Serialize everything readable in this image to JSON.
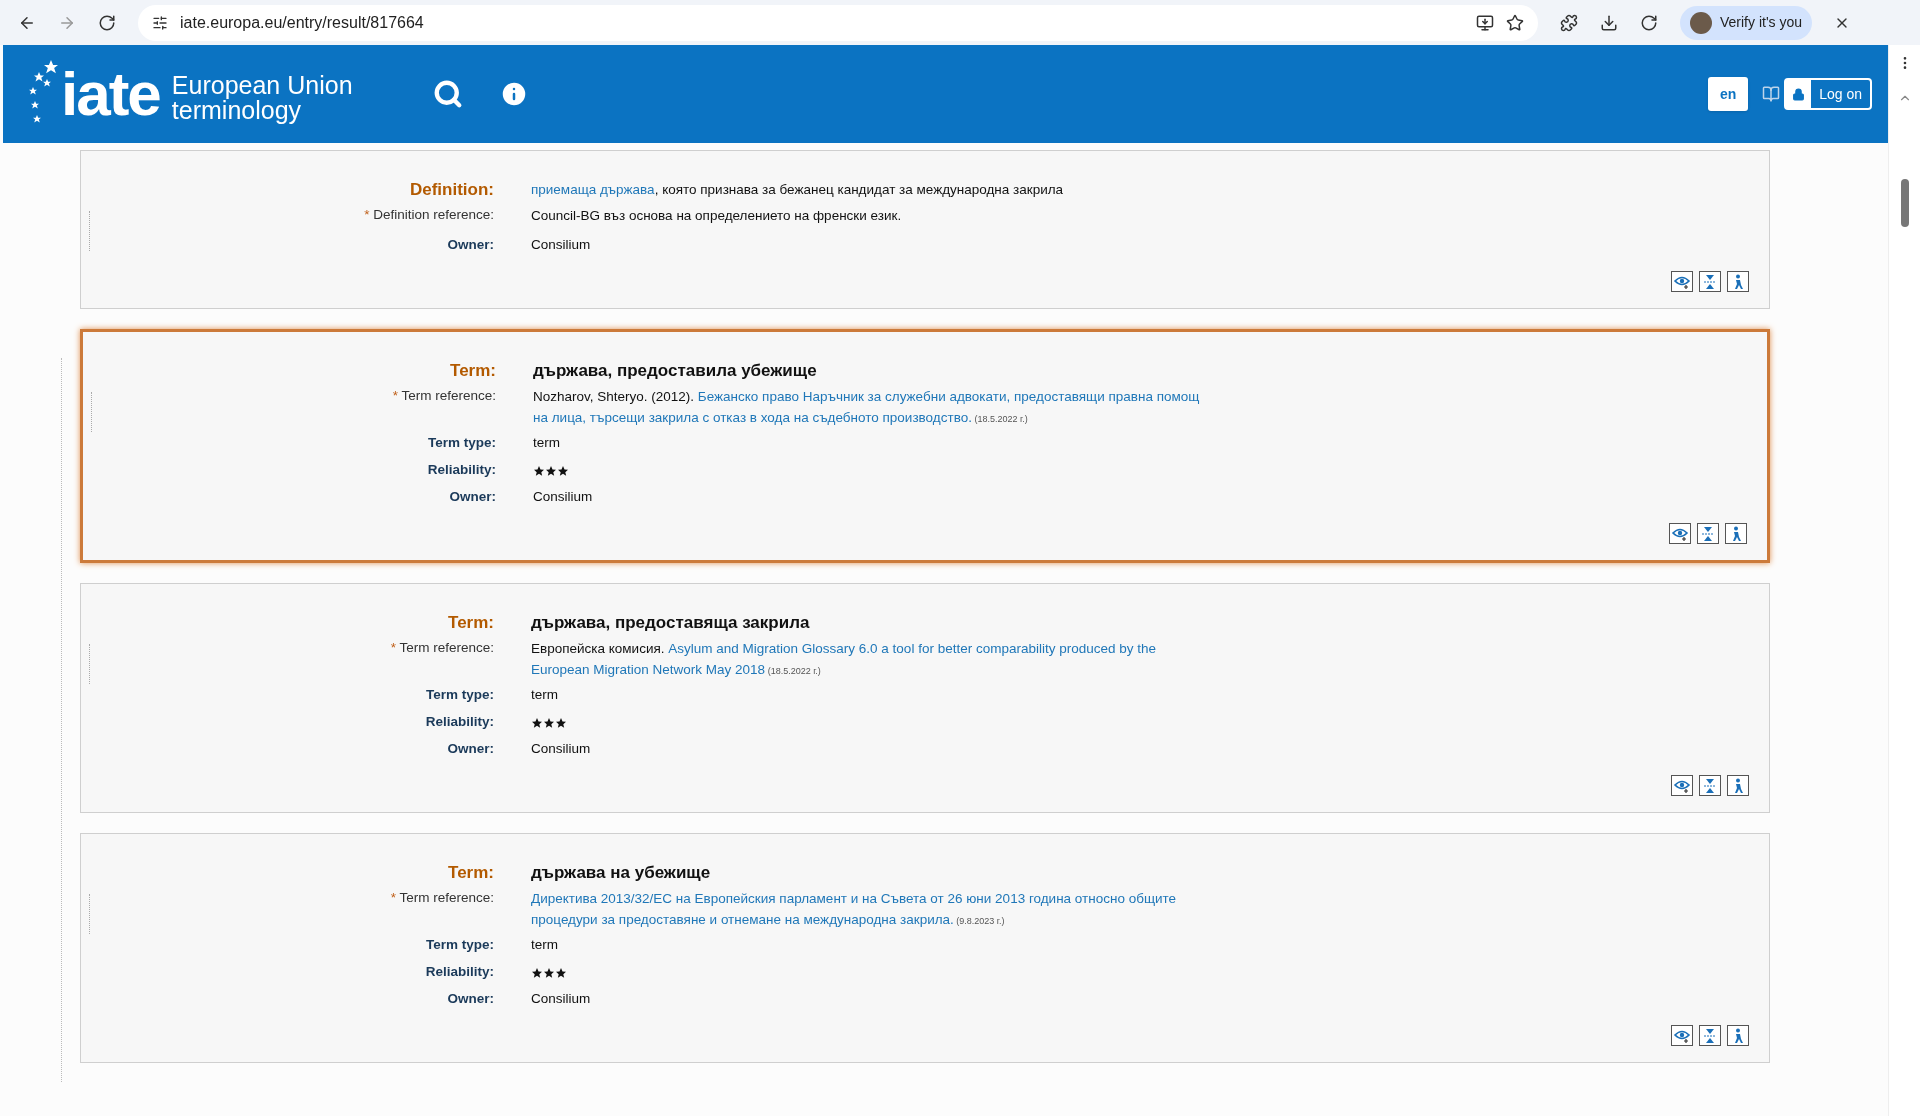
{
  "browser": {
    "url": "iate.europa.eu/entry/result/817664",
    "profile_label": "Verify it's you"
  },
  "header": {
    "logo_text": "iate",
    "logo_line_1": "European Union",
    "logo_line_2": "terminology",
    "language": "en",
    "login": "Log on"
  },
  "entries": [
    {
      "kind": "definition",
      "selected": false,
      "heading_label": "Definition:",
      "heading_link": "приемаща държава",
      "heading_text": ", която признава за бежанец кандидат за международна закрила",
      "fields": [
        {
          "kind": "reference",
          "marker": "*",
          "label": "Definition reference:",
          "prefix": "Council-BG въз основа на определението на френски език."
        },
        {
          "kind": "text",
          "label": "Owner:",
          "value": "Consilium"
        }
      ]
    },
    {
      "kind": "term",
      "selected": true,
      "heading_label": "Term:",
      "heading_text": "държава, предоставила убежище",
      "fields": [
        {
          "kind": "reference",
          "marker": "*",
          "label": "Term reference:",
          "prefix": "Nozharov, Shteryo. (2012). ",
          "link_lines": [
            "Бежанско право Наръчник за служебни адвокати, предоставящи правна помощ",
            "на лица, търсещи закрила с отказ в хода на съдебното производство."
          ],
          "date": "(18.5.2022 г.)"
        },
        {
          "kind": "text",
          "label": "Term type:",
          "value": "term"
        },
        {
          "kind": "stars",
          "label": "Reliability:",
          "stars": 3
        },
        {
          "kind": "text",
          "label": "Owner:",
          "value": "Consilium"
        }
      ]
    },
    {
      "kind": "term",
      "selected": false,
      "heading_label": "Term:",
      "heading_text": "държава, предоставяща закрила",
      "fields": [
        {
          "kind": "reference",
          "marker": "*",
          "label": "Term reference:",
          "prefix": "Европейска комисия. ",
          "link_lines": [
            "Asylum and Migration Glossary 6.0 a tool for better comparability produced by the",
            "European Migration Network May 2018"
          ],
          "date": "(18.5.2022 г.)"
        },
        {
          "kind": "text",
          "label": "Term type:",
          "value": "term"
        },
        {
          "kind": "stars",
          "label": "Reliability:",
          "stars": 3
        },
        {
          "kind": "text",
          "label": "Owner:",
          "value": "Consilium"
        }
      ]
    },
    {
      "kind": "term",
      "selected": false,
      "heading_label": "Term:",
      "heading_text": "държава на убежище",
      "fields": [
        {
          "kind": "reference",
          "marker": "*",
          "label": "Term reference:",
          "link_lines": [
            "Директива 2013/32/ЕС на Европейския парламент и на Съвета от 26 юни 2013 година относно общите",
            "процедури за предоставяне и отнемане на международна закрила."
          ],
          "date": "(9.8.2023 г.)"
        },
        {
          "kind": "text",
          "label": "Term type:",
          "value": "term"
        },
        {
          "kind": "stars",
          "label": "Reliability:",
          "stars": 3
        },
        {
          "kind": "text",
          "label": "Owner:",
          "value": "Consilium"
        }
      ]
    }
  ]
}
